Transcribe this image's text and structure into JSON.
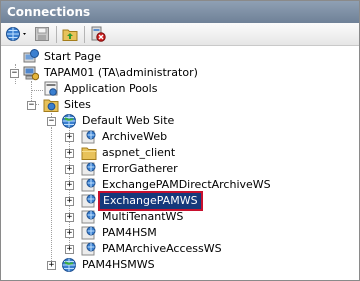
{
  "header": {
    "title": "Connections"
  },
  "toolbar": {
    "connect_icon": "globe-connect-icon",
    "save_icon": "save-icon",
    "up_icon": "folder-up-icon",
    "disconnect_icon": "disconnect-icon"
  },
  "tree": {
    "start_page": "Start Page",
    "server": "TAPAM01 (TA\\administrator)",
    "app_pools": "Application Pools",
    "sites": "Sites",
    "default_site": "Default Web Site",
    "children": [
      "ArchiveWeb",
      "aspnet_client",
      "ErrorGatherer",
      "ExchangePAMDirectArchiveWS",
      "ExchangePAMWS",
      "MultiTenantWS",
      "PAM4HSM",
      "PAMArchiveAccessWS"
    ],
    "selected": "ExchangePAMWS",
    "other_site": "PAM4HSMWS"
  },
  "colors": {
    "header": "#7b8ca1",
    "selection": "#15397b",
    "selection_outline": "#c8102e"
  }
}
